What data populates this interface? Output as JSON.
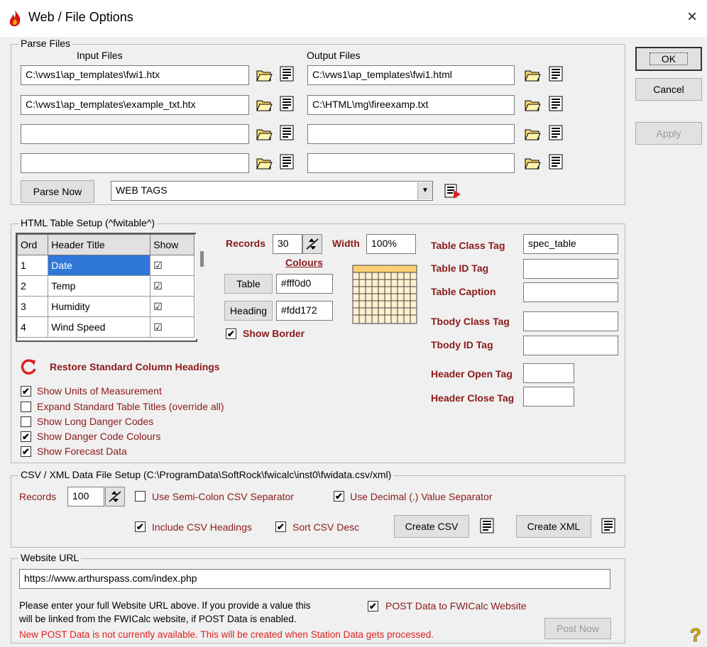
{
  "window": {
    "title": "Web / File Options",
    "close_label": "×"
  },
  "parse": {
    "legend": "Parse Files",
    "input_header": "Input Files",
    "output_header": "Output Files",
    "inputs": [
      "C:\\vws1\\ap_templates\\fwi1.htx",
      "C:\\vws1\\ap_templates\\example_txt.htx",
      "",
      ""
    ],
    "outputs": [
      "C:\\vws1\\ap_templates\\fwi1.html",
      "C:\\HTML\\mg\\fireexamp.txt",
      "",
      ""
    ],
    "parse_now_label": "Parse Now",
    "tags_select": "WEB TAGS"
  },
  "side_buttons": {
    "ok": "OK",
    "cancel": "Cancel",
    "apply": "Apply"
  },
  "html_table": {
    "legend": "HTML Table Setup (^fwitable^)",
    "columns": [
      "Ord",
      "Header Title",
      "Show"
    ],
    "rows": [
      {
        "ord": "1",
        "title": "Date",
        "show": "☑"
      },
      {
        "ord": "2",
        "title": "Temp",
        "show": "☑"
      },
      {
        "ord": "3",
        "title": "Humidity",
        "show": "☑"
      },
      {
        "ord": "4",
        "title": "Wind Speed",
        "show": "☑"
      }
    ],
    "records_label": "Records",
    "records_value": "30",
    "width_label": "Width",
    "width_value": "100%",
    "colours_label": "Colours",
    "table_btn": "Table",
    "table_colour": "#fff0d0",
    "heading_btn": "Heading",
    "heading_colour": "#fdd172",
    "show_border_label": "Show Border",
    "restore_label": "Restore Standard Column Headings",
    "options": [
      {
        "label": "Show Units of Measurement",
        "checked": "✔"
      },
      {
        "label": "Expand Standard Table Titles (override all)",
        "checked": ""
      },
      {
        "label": "Show Long Danger Codes",
        "checked": ""
      },
      {
        "label": "Show Danger Code Colours",
        "checked": "✔"
      },
      {
        "label": "Show Forecast Data",
        "checked": "✔"
      }
    ],
    "table_class_label": "Table Class Tag",
    "table_class_value": "spec_table",
    "table_id_label": "Table ID Tag",
    "table_caption_label": "Table Caption",
    "tbody_class_label": "Tbody Class Tag",
    "tbody_id_label": "Tbody ID Tag",
    "header_open_label": "Header Open Tag",
    "header_close_label": "Header Close Tag"
  },
  "csv": {
    "legend": "CSV / XML Data File Setup (C:\\ProgramData\\SoftRock\\fwicalc\\inst0\\fwidata.csv/xml)",
    "records_label": "Records",
    "records_value": "100",
    "semicolon_label": "Use Semi-Colon CSV Separator",
    "decimal_label": "Use Decimal (.) Value Separator",
    "headings_label": "Include CSV Headings",
    "sort_label": "Sort CSV Desc",
    "create_csv": "Create CSV",
    "create_xml": "Create XML"
  },
  "website": {
    "legend": "Website URL",
    "url": "https://www.arthurspass.com/index.php",
    "info1": "Please enter your full Website URL above. If you provide a value this",
    "info2": "will be linked from the FWICalc website, if POST Data is enabled.",
    "post_label": "POST Data to FWICalc Website",
    "notice": "New POST Data is not currently available. This will be created when Station Data gets processed.",
    "post_now": "Post Now"
  },
  "colors": {
    "selected": "#3078d8",
    "label_red": "#8b1a1a",
    "notice_red": "#e02020",
    "swatch_header": "#fdd172",
    "swatch_body": "#fff0d0"
  }
}
